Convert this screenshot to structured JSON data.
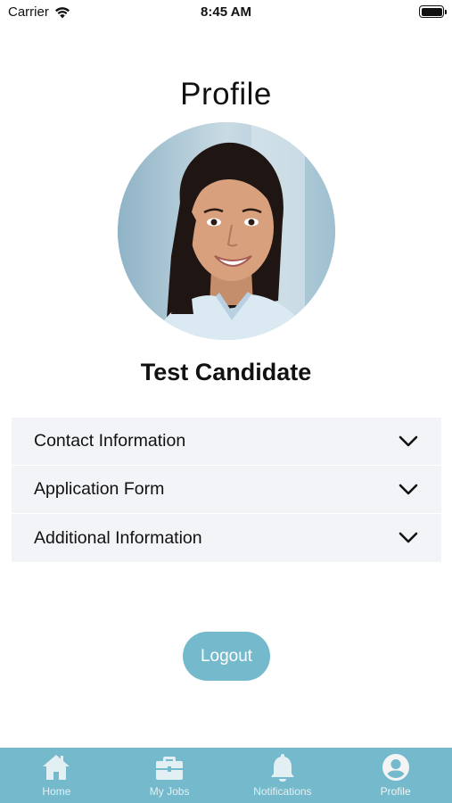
{
  "status_bar": {
    "carrier": "Carrier",
    "time": "8:45 AM"
  },
  "page": {
    "title": "Profile",
    "candidate_name": "Test Candidate"
  },
  "accordion": [
    {
      "label": "Contact Information",
      "icon": "chevron-down-icon"
    },
    {
      "label": "Application Form",
      "icon": "chevron-down-icon"
    },
    {
      "label": "Additional Information",
      "icon": "chevron-down-icon"
    }
  ],
  "logout_label": "Logout",
  "tab_bar": {
    "tabs": [
      {
        "label": "Home",
        "icon": "home-icon",
        "active": false
      },
      {
        "label": "My Jobs",
        "icon": "briefcase-icon",
        "active": false
      },
      {
        "label": "Notifications",
        "icon": "bell-icon",
        "active": false
      },
      {
        "label": "Profile",
        "icon": "user-circle-icon",
        "active": true
      }
    ]
  },
  "colors": {
    "accent": "#74b9cc",
    "row_background": "#f3f4f7",
    "text": "#111111"
  }
}
